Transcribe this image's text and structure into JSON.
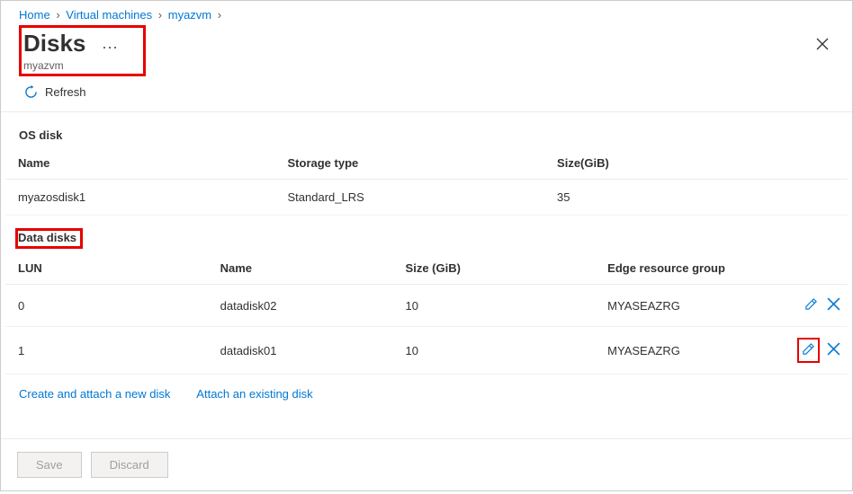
{
  "breadcrumb": [
    {
      "label": "Home"
    },
    {
      "label": "Virtual machines"
    },
    {
      "label": "myazvm"
    }
  ],
  "page": {
    "title": "Disks",
    "subtitle": "myazvm"
  },
  "toolbar": {
    "refresh_label": "Refresh"
  },
  "os_disk_section": {
    "label": "OS disk",
    "columns": {
      "name": "Name",
      "storage_type": "Storage type",
      "size": "Size(GiB)"
    },
    "rows": [
      {
        "name": "myazosdisk1",
        "storage_type": "Standard_LRS",
        "size": "35"
      }
    ]
  },
  "data_disks_section": {
    "label": "Data disks",
    "columns": {
      "lun": "LUN",
      "name": "Name",
      "size": "Size (GiB)",
      "erg": "Edge resource group"
    },
    "rows": [
      {
        "lun": "0",
        "name": "datadisk02",
        "size": "10",
        "erg": "MYASEAZRG"
      },
      {
        "lun": "1",
        "name": "datadisk01",
        "size": "10",
        "erg": "MYASEAZRG"
      }
    ]
  },
  "links": {
    "create_attach": "Create and attach a new disk",
    "attach_existing": "Attach an existing disk"
  },
  "footer": {
    "save": "Save",
    "discard": "Discard"
  },
  "colors": {
    "link": "#0078d4",
    "highlight": "#e60000"
  }
}
